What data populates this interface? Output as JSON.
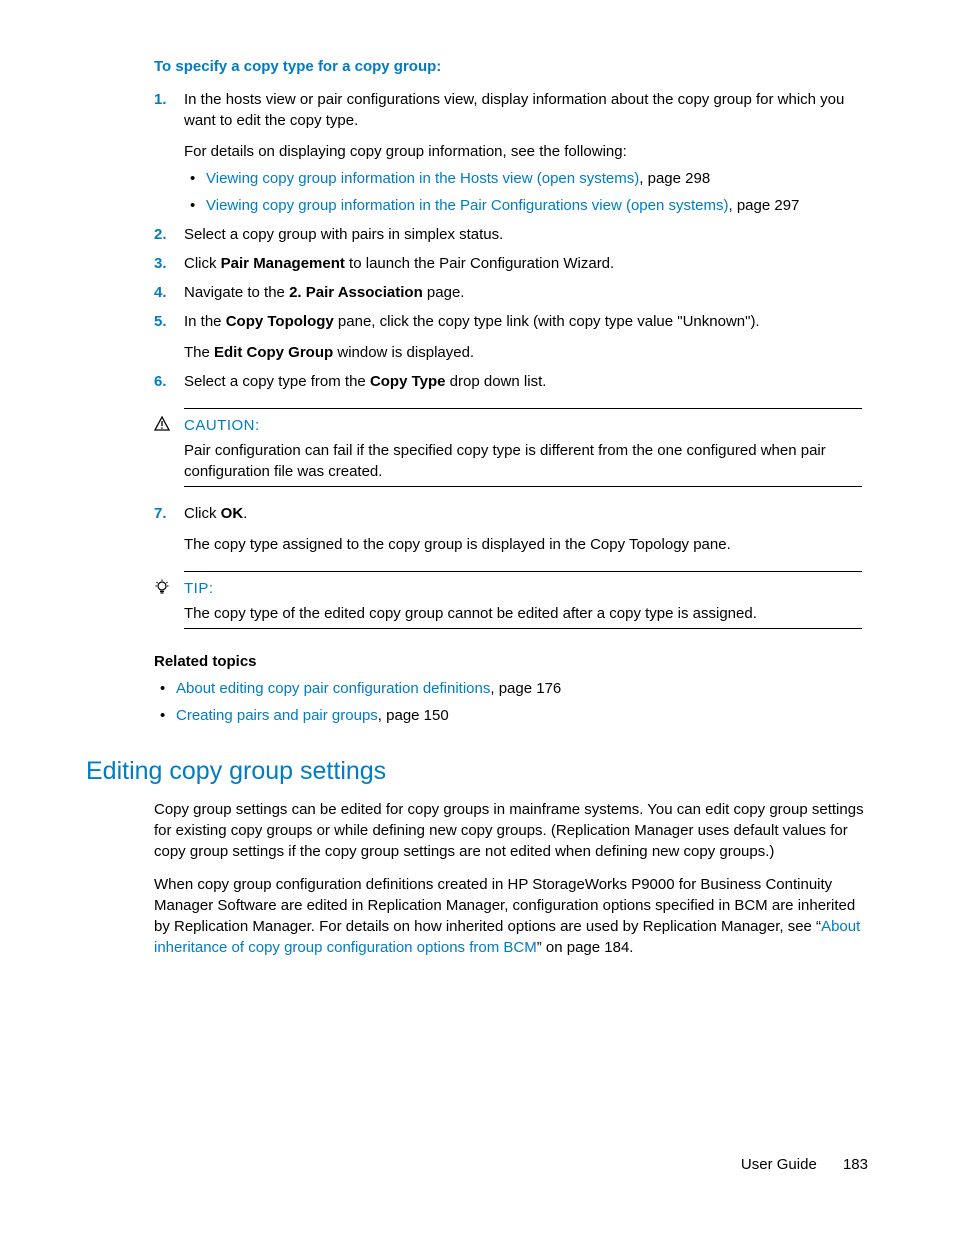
{
  "procHeading": "To specify a copy type for a copy group:",
  "steps": {
    "s1": {
      "num": "1.",
      "text": "In the hosts view or pair configurations view, display information about the copy group for which you want to edit the copy type.",
      "sub": "For details on displaying copy group information, see the following:",
      "b1_link": "Viewing copy group information in the Hosts view (open systems)",
      "b1_tail": ", page 298",
      "b2_link": "Viewing copy group information in the Pair Configurations view (open systems)",
      "b2_tail": ", page 297"
    },
    "s2": {
      "num": "2.",
      "text": "Select a copy group with pairs in simplex status."
    },
    "s3": {
      "num": "3.",
      "pre": "Click ",
      "bold": "Pair Management",
      "post": " to launch the Pair Configuration Wizard."
    },
    "s4": {
      "num": "4.",
      "pre": "Navigate to the ",
      "bold": "2. Pair Association",
      "post": " page."
    },
    "s5": {
      "num": "5.",
      "pre": "In the ",
      "bold": "Copy Topology",
      "post": " pane, click the copy type link (with copy type value \"Unknown\").",
      "sub_pre": "The ",
      "sub_bold": "Edit Copy Group",
      "sub_post": " window is displayed."
    },
    "s6": {
      "num": "6.",
      "pre": "Select a copy type from the ",
      "bold": "Copy Type",
      "post": " drop down list."
    },
    "s7": {
      "num": "7.",
      "pre": "Click ",
      "bold": "OK",
      "post": ".",
      "sub": "The copy type assigned to the copy group is displayed in the Copy Topology pane."
    }
  },
  "caution": {
    "label": "CAUTION:",
    "text": "Pair configuration can fail if the specified copy type is different from the one configured when pair configuration file was created."
  },
  "tip": {
    "label": "TIP:",
    "text": "The copy type of the edited copy group cannot be edited after a copy type is assigned."
  },
  "relatedHeading": "Related topics",
  "related": {
    "r1_link": "About editing copy pair configuration definitions",
    "r1_tail": ", page 176",
    "r2_link": "Creating pairs and pair groups",
    "r2_tail": ", page 150"
  },
  "sectionTitle": "Editing copy group settings",
  "para1": "Copy group settings can be edited for copy groups in mainframe systems. You can edit copy group settings for existing copy groups or while defining new copy groups. (Replication Manager uses default values for copy group settings if the copy group settings are not edited when defining new copy groups.)",
  "para2_pre": "When copy group configuration definitions created in HP StorageWorks P9000 for Business Continuity Manager Software are edited in Replication Manager, configuration options specified in BCM are inherited by Replication Manager. For details on how inherited options are used by Replication Manager, see “",
  "para2_link": "About inheritance of copy group configuration options from BCM",
  "para2_post": "” on page 184.",
  "footer": {
    "label": "User Guide",
    "page": "183"
  }
}
